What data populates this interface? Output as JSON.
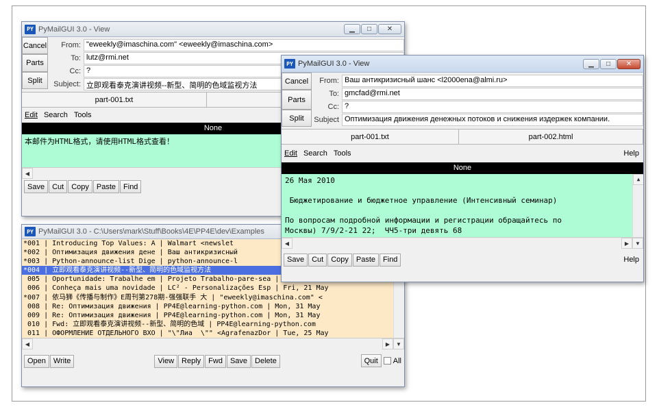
{
  "w1": {
    "title": "PyMailGUI 3.0 - View",
    "buttons": [
      "Cancel",
      "Parts",
      "Split"
    ],
    "from_label": "From:",
    "from": "\"eweekly@imaschina.com\" <eweekly@imaschina.com>",
    "to_label": "To:",
    "to": "lutz@rmi.net",
    "cc_label": "Cc:",
    "cc": "?",
    "subject_label": "Subject:",
    "subject": "立即观看泰克演讲视频--新型、简明的色域监视方法",
    "part1": "part-001.txt",
    "menu": [
      "Edit",
      "Search",
      "Tools"
    ],
    "none": "None",
    "body": "本邮件为HTML格式，请使用HTML格式查看！",
    "toolbar": [
      "Save",
      "Cut",
      "Copy",
      "Paste",
      "Find"
    ]
  },
  "w2": {
    "title": "PyMailGUI 3.0 - C:\\Users\\mark\\Stuff\\Books\\4E\\PP4E\\dev\\Examples",
    "rows": [
      "*001 | Introducing Top Values: A | Walmart <newslet",
      "*002 | Оптимизация движения дене | Ваш антикризисный",
      "*003 | Python-announce-list Dige | python-announce-l",
      "*004 | 立即观看泰克演讲视频--新型、简明的色域监视方法",
      " 005 | Oportunidade: Trabalhe em | Projeto Trabalho-pare-sea | sun, 30 May",
      " 006 | Conheça mais uma novidade | LC² - Personalizações Esp | Fri, 21 May",
      "*007 | 依马狮《传播与制作》E周刊第278期-强强联手 大 | \"eweekly@imaschina.com\" <",
      " 008 | Re: Оптимизация движения | PP4E@learning-python.com | Mon, 31 May",
      " 009 | Re: Оптимизация движения | PP4E@learning-python.com | Mon, 31 May",
      " 010 | Fwd: 立即观看泰克演讲视频--新型、简明的色域 | PP4E@learning-python.com",
      " 011 | ОФОРМЛЕНИЕ ОТДЕЛЬНОГО ВХО | \"\\\"Лиа  \\\"\" <AgrafenazDor | Tue, 25 May"
    ],
    "selected_index": 3,
    "buttons_left": [
      "Open",
      "Write"
    ],
    "buttons_mid": [
      "View",
      "Reply",
      "Fwd",
      "Save",
      "Delete"
    ],
    "quit": "Quit",
    "all": "All"
  },
  "w3": {
    "title": "PyMailGUI 3.0 - View",
    "buttons": [
      "Cancel",
      "Parts",
      "Split"
    ],
    "from_label": "From:",
    "from": "Ваш антикризисный шанс <l2000ena@almi.ru>",
    "to_label": "To:",
    "to": "gmcfad@rmi.net",
    "cc_label": "Cc:",
    "cc": "?",
    "subject_label": "Subject",
    "subject": "Оптимизация движения денежных потоков и снижения издержек компании.",
    "part1": "part-001.txt",
    "part2": "part-002.html",
    "menu": [
      "Edit",
      "Search",
      "Tools"
    ],
    "help": "Help",
    "none": "None",
    "body_lines": [
      "26 Мая 2010",
      "",
      " Бюджетирование и бюджетное управление (Интенсивный семинар)",
      "",
      "По вопросам подробной информации и регистрации обращайтесь по",
      "Москвы) 7/9/2-21 22;  ЧЧ5-три девять 68"
    ],
    "toolbar": [
      "Save",
      "Cut",
      "Copy",
      "Paste",
      "Find"
    ],
    "toolbar_help": "Help"
  }
}
